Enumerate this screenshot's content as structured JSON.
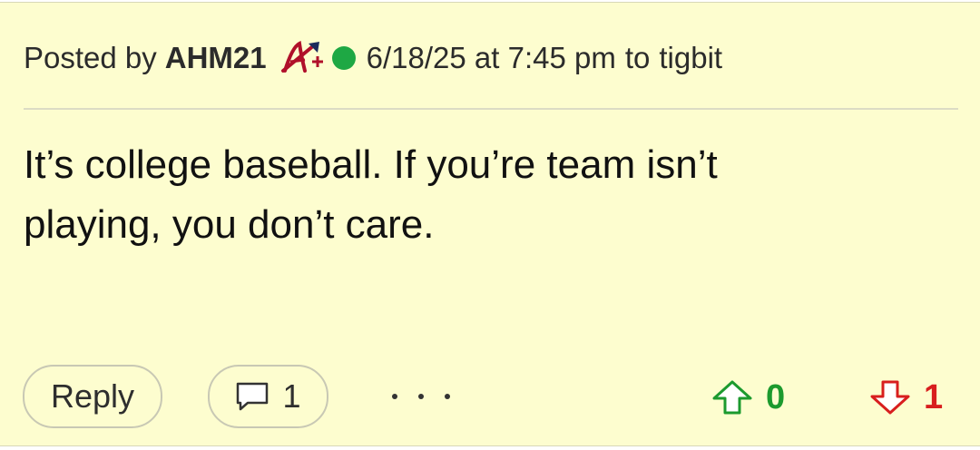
{
  "post": {
    "posted_by_prefix": "Posted by",
    "author": "AHM21",
    "team_logo": "atlanta-braves-logo",
    "online_status_color": "#1ea844",
    "date_time": "6/18/25 at 7:45 pm",
    "to_word": "to",
    "recipient": "tigbit",
    "body_line_1": "It’s college baseball. If you’re team isn’t",
    "body_line_2": "playing, you don’t care."
  },
  "actions": {
    "reply_label": "Reply",
    "comment_icon": "speech-bubble-icon",
    "comment_count": "1",
    "more_icon": "ellipsis-icon",
    "upvote_icon": "arrow-up-icon",
    "upvote_count": "0",
    "upvote_color": "#1c9a2e",
    "downvote_icon": "arrow-down-icon",
    "downvote_count": "1",
    "downvote_color": "#d81e1e"
  },
  "colors": {
    "post_background": "#fdfdcf",
    "button_border": "#c8c8b4"
  }
}
